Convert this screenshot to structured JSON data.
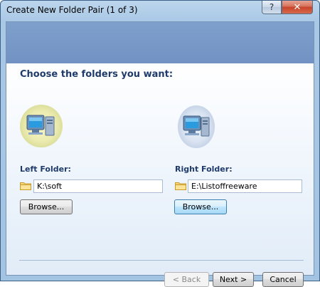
{
  "window": {
    "title": "Create New Folder Pair (1 of 3)",
    "help_label": "?",
    "close_label": "✕"
  },
  "main": {
    "heading": "Choose the folders you want:"
  },
  "left": {
    "label": "Left Folder:",
    "path": "K:\\soft",
    "browse_label": "Browse..."
  },
  "right": {
    "label": "Right Folder:",
    "path": "E:\\Listoffreeware",
    "browse_label": "Browse..."
  },
  "footer": {
    "back_label": "< Back",
    "next_label": "Next >",
    "cancel_label": "Cancel"
  },
  "icons": {
    "computer": "computer-icon",
    "folder": "folder-icon"
  }
}
